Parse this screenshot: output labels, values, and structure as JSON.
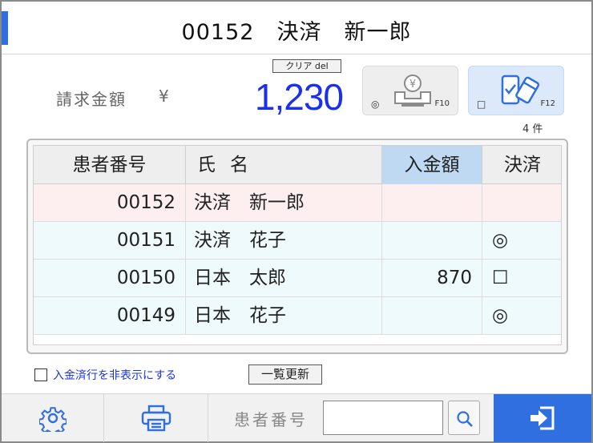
{
  "header": {
    "title": "00152　決済　新一郎"
  },
  "billing": {
    "label": "請求金額",
    "currency": "¥",
    "amount": "1,230",
    "clear_label": "クリア del",
    "amount_color": "#1a2ff0"
  },
  "payment_methods": {
    "cash": {
      "radio": "◎",
      "key": "F10",
      "icon": "cash-register-icon"
    },
    "card": {
      "radio": "□",
      "key": "F12",
      "icon": "card-phone-icon"
    },
    "count": "4 件"
  },
  "table": {
    "headers": {
      "patient_no": "患者番号",
      "name": "氏名",
      "deposit": "入金額",
      "settlement": "決済"
    },
    "rows": [
      {
        "patient_no": "00152",
        "name": "決済　新一郎",
        "deposit": "",
        "settlement": ""
      },
      {
        "patient_no": "00151",
        "name": "決済　花子",
        "deposit": "",
        "settlement": "◎"
      },
      {
        "patient_no": "00150",
        "name": "日本　太郎",
        "deposit": "870",
        "settlement": "☐"
      },
      {
        "patient_no": "00149",
        "name": "日本　花子",
        "deposit": "",
        "settlement": "◎"
      }
    ]
  },
  "options": {
    "hide_paid_label": "入金済行を非表示にする",
    "hide_paid_checked": false,
    "refresh_label": "一覧更新"
  },
  "footer": {
    "settings_icon": "gear-icon",
    "print_icon": "printer-icon",
    "patient_no_label": "患者番号",
    "patient_no_value": "",
    "search_icon": "search-icon",
    "exit_icon": "exit-icon",
    "accent_color": "#2f6fe0"
  }
}
